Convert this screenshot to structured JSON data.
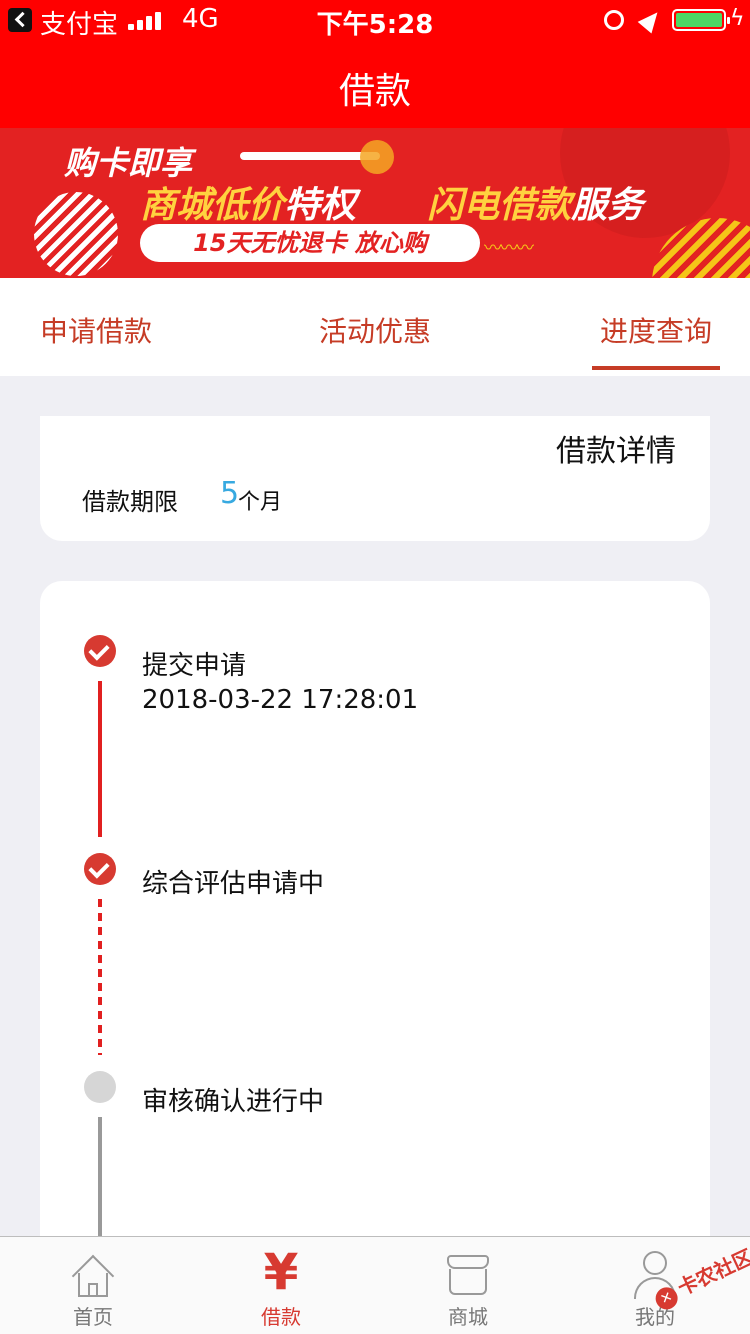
{
  "status_bar": {
    "back_app": "支付宝",
    "network": "4G",
    "time": "下午5:28"
  },
  "nav": {
    "title": "借款"
  },
  "banner": {
    "line1": "购卡即享",
    "line2_a": "商城低价",
    "line2_b": "特权",
    "line2_c": "闪电借款",
    "line2_d": "服务",
    "pill_text": "15天无忧退卡  放心购"
  },
  "tabs": [
    {
      "label": "申请借款",
      "active": false
    },
    {
      "label": "活动优惠",
      "active": false
    },
    {
      "label": "进度查询",
      "active": true
    }
  ],
  "loan_card": {
    "heading": "借款详情",
    "term_label": "借款期限",
    "term_value": "5",
    "term_unit": "个月"
  },
  "progress": [
    {
      "title": "提交申请",
      "time": "2018-03-22 17:28:01",
      "state": "done"
    },
    {
      "title": "综合评估申请中",
      "time": "",
      "state": "done"
    },
    {
      "title": "审核确认进行中",
      "time": "",
      "state": "pending"
    }
  ],
  "tabbar": [
    {
      "label": "首页",
      "icon": "home-icon",
      "active": false
    },
    {
      "label": "借款",
      "icon": "yen-icon",
      "active": true
    },
    {
      "label": "商城",
      "icon": "shop-icon",
      "active": false
    },
    {
      "label": "我的",
      "icon": "user-icon",
      "active": false
    }
  ],
  "watermark": {
    "text": "卡农社区"
  },
  "colors": {
    "primary_red": "#ff0000",
    "tab_red": "#c63c26",
    "accent_blue": "#37a9e0",
    "step_done": "#d73a31",
    "step_pending": "#d6d6d6"
  }
}
